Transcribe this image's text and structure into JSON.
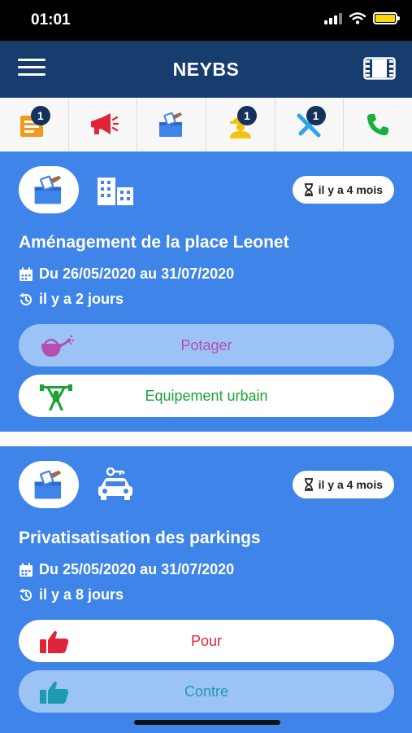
{
  "status_bar": {
    "time": "01:01"
  },
  "header": {
    "title": "NEYBS"
  },
  "categories": [
    {
      "icon": "document-list-icon",
      "badge": "1"
    },
    {
      "icon": "megaphone-icon",
      "badge": ""
    },
    {
      "icon": "ballot-box-icon",
      "badge": ""
    },
    {
      "icon": "worker-icon",
      "badge": "1"
    },
    {
      "icon": "tools-icon",
      "badge": "1"
    },
    {
      "icon": "phone-icon",
      "badge": ""
    }
  ],
  "cards": [
    {
      "vote_icon": "ballot-box-icon",
      "category_icon": "building-icon",
      "age": "il y a 4 mois",
      "title": "Aménagement de la place Leonet",
      "dates": "Du 26/05/2020 au 31/07/2020",
      "updated": "il y a 2 jours",
      "options": [
        {
          "label": "Potager",
          "icon": "watering-can-icon",
          "color": "#b84fb0",
          "selected": true
        },
        {
          "label": "Equipement urbain",
          "icon": "weightlifter-icon",
          "color": "#1aa335",
          "selected": false
        }
      ]
    },
    {
      "vote_icon": "ballot-box-icon",
      "category_icon": "car-key-icon",
      "age": "il y a 4 mois",
      "title": "Privatisatisation des parkings",
      "dates": "Du 25/05/2020 au 31/07/2020",
      "updated": "il y a 8 jours",
      "options": [
        {
          "label": "Pour",
          "icon": "thumbs-up-icon",
          "color": "#e0243a",
          "selected": false
        },
        {
          "label": "Contre",
          "icon": "thumbs-up-icon",
          "color": "#1e9bb0",
          "selected": true
        }
      ]
    }
  ],
  "colors": {
    "header": "#173d6f",
    "card": "#3f84e8",
    "selected_option": "#9cc3f5"
  }
}
